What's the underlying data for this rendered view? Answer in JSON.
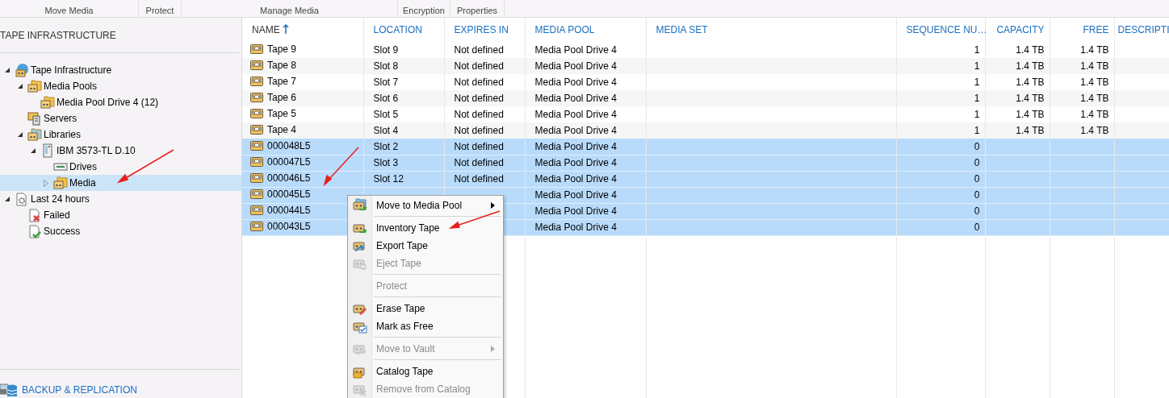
{
  "ribbon": {
    "groups": [
      "Move Media",
      "Protect",
      "Manage Media",
      "Encryption",
      "Properties"
    ]
  },
  "sidebar": {
    "title": "TAPE INFRASTRUCTURE",
    "tree": [
      {
        "label": "Tape Infrastructure",
        "expanded": true,
        "selected": false,
        "children": [
          {
            "label": "Media Pools",
            "expanded": true,
            "selected": false,
            "children": [
              {
                "label": "Media Pool Drive 4 (12)",
                "selected": false
              }
            ]
          },
          {
            "label": "Servers",
            "selected": false
          },
          {
            "label": "Libraries",
            "expanded": true,
            "selected": false,
            "children": [
              {
                "label": "IBM 3573-TL D.10",
                "expanded": true,
                "selected": false,
                "children": [
                  {
                    "label": "Drives",
                    "selected": false
                  },
                  {
                    "label": "Media",
                    "expanded": false,
                    "selected": true
                  }
                ]
              }
            ]
          }
        ]
      },
      {
        "label": "Last 24 hours",
        "expanded": true,
        "selected": false,
        "children": [
          {
            "label": "Failed",
            "selected": false
          },
          {
            "label": "Success",
            "selected": false
          }
        ]
      }
    ],
    "footer": "BACKUP & REPLICATION"
  },
  "table": {
    "columns": [
      {
        "label": "NAME",
        "kind": "text",
        "sorted": true
      },
      {
        "label": "LOCATION",
        "kind": "text",
        "sorted": false
      },
      {
        "label": "EXPIRES IN",
        "kind": "text",
        "sorted": false
      },
      {
        "label": "MEDIA POOL",
        "kind": "text",
        "sorted": false
      },
      {
        "label": "MEDIA SET",
        "kind": "text",
        "sorted": false
      },
      {
        "label": "SEQUENCE NU…",
        "kind": "number",
        "sorted": false
      },
      {
        "label": "CAPACITY",
        "kind": "number",
        "sorted": false
      },
      {
        "label": "FREE",
        "kind": "number",
        "sorted": false
      },
      {
        "label": "DESCRIPTI",
        "kind": "text",
        "sorted": false
      }
    ],
    "rows": [
      {
        "selected": false,
        "cells": [
          "Tape 9",
          "Slot 9",
          "Not defined",
          "Media Pool Drive 4",
          null,
          "1",
          "1.4 TB",
          "1.4 TB",
          null
        ]
      },
      {
        "selected": false,
        "cells": [
          "Tape 8",
          "Slot 8",
          "Not defined",
          "Media Pool Drive 4",
          null,
          "1",
          "1.4 TB",
          "1.4 TB",
          null
        ]
      },
      {
        "selected": false,
        "cells": [
          "Tape 7",
          "Slot 7",
          "Not defined",
          "Media Pool Drive 4",
          null,
          "1",
          "1.4 TB",
          "1.4 TB",
          null
        ]
      },
      {
        "selected": false,
        "cells": [
          "Tape 6",
          "Slot 6",
          "Not defined",
          "Media Pool Drive 4",
          null,
          "1",
          "1.4 TB",
          "1.4 TB",
          null
        ]
      },
      {
        "selected": false,
        "cells": [
          "Tape 5",
          "Slot 5",
          "Not defined",
          "Media Pool Drive 4",
          null,
          "1",
          "1.4 TB",
          "1.4 TB",
          null
        ]
      },
      {
        "selected": false,
        "cells": [
          "Tape 4",
          "Slot 4",
          "Not defined",
          "Media Pool Drive 4",
          null,
          "1",
          "1.4 TB",
          "1.4 TB",
          null
        ]
      },
      {
        "selected": true,
        "cells": [
          "000048L5",
          "Slot 2",
          "Not defined",
          "Media Pool Drive 4",
          null,
          "0",
          null,
          null,
          null
        ]
      },
      {
        "selected": true,
        "cells": [
          "000047L5",
          "Slot 3",
          "Not defined",
          "Media Pool Drive 4",
          null,
          "0",
          null,
          null,
          null
        ]
      },
      {
        "selected": true,
        "cells": [
          "000046L5",
          "Slot 12",
          "Not defined",
          "Media Pool Drive 4",
          null,
          "0",
          null,
          null,
          null
        ]
      },
      {
        "selected": true,
        "cells": [
          "000045L5",
          null,
          null,
          "Media Pool Drive 4",
          null,
          "0",
          null,
          null,
          null
        ]
      },
      {
        "selected": true,
        "cells": [
          "000044L5",
          null,
          null,
          "Media Pool Drive 4",
          null,
          "0",
          null,
          null,
          null
        ]
      },
      {
        "selected": true,
        "cells": [
          "000043L5",
          null,
          null,
          "Media Pool Drive 4",
          null,
          "0",
          null,
          null,
          null
        ]
      }
    ]
  },
  "context_menu": {
    "items": [
      {
        "kind": "item",
        "label": "Move to Media Pool",
        "disabled": false,
        "submenu": true
      },
      {
        "kind": "separator"
      },
      {
        "kind": "item",
        "label": "Inventory Tape",
        "disabled": false,
        "submenu": false
      },
      {
        "kind": "item",
        "label": "Export Tape",
        "disabled": false,
        "submenu": false
      },
      {
        "kind": "item",
        "label": "Eject Tape",
        "disabled": true,
        "submenu": false
      },
      {
        "kind": "separator"
      },
      {
        "kind": "item",
        "label": "Protect",
        "disabled": true,
        "submenu": false
      },
      {
        "kind": "separator"
      },
      {
        "kind": "item",
        "label": "Erase Tape",
        "disabled": false,
        "submenu": false
      },
      {
        "kind": "item",
        "label": "Mark as Free",
        "disabled": false,
        "submenu": false
      },
      {
        "kind": "separator"
      },
      {
        "kind": "item",
        "label": "Move to Vault",
        "disabled": true,
        "submenu": true
      },
      {
        "kind": "separator"
      },
      {
        "kind": "item",
        "label": "Catalog Tape",
        "disabled": false,
        "submenu": false
      },
      {
        "kind": "item",
        "label": "Remove from Catalog",
        "disabled": true,
        "submenu": false
      }
    ]
  }
}
